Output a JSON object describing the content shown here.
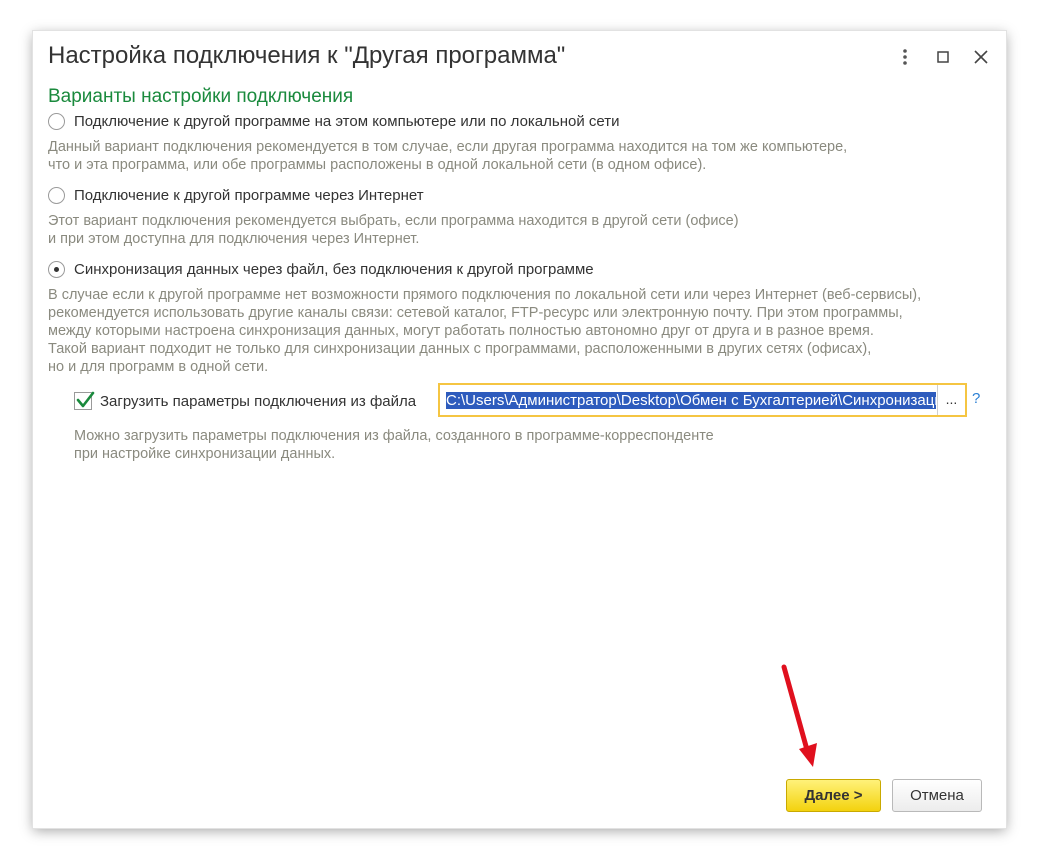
{
  "window": {
    "title": "Настройка подключения к \"Другая программа\"",
    "more_icon": "more-vertical-icon",
    "maximize_icon": "maximize-icon",
    "close_icon": "close-icon"
  },
  "section_title": "Варианты настройки подключения",
  "options": [
    {
      "label": "Подключение к другой программе на этом компьютере или по локальной сети",
      "selected": false,
      "description": [
        "Данный вариант подключения рекомендуется в том случае, если другая программа находится на том же компьютере,",
        "что и эта программа, или обе программы расположены в одной локальной сети (в одном офисе)."
      ]
    },
    {
      "label": "Подключение к другой программе через Интернет",
      "selected": false,
      "description": [
        "Этот вариант подключения рекомендуется выбрать, если программа находится в другой сети (офисе)",
        "и при этом доступна для подключения через Интернет."
      ]
    },
    {
      "label": "Синхронизация данных через файл, без подключения к другой программе",
      "selected": true,
      "description": [
        "В случае если к другой программе нет возможности прямого подключения по локальной сети или через Интернет (веб-сервисы),",
        "рекомендуется использовать другие каналы связи: сетевой каталог, FTP-ресурс или электронную почту. При этом программы,",
        "между которыми настроена синхронизация данных, могут работать полностью автономно друг от друга и в разное время.",
        "Такой вариант подходит не только для синхронизации данных с программами, расположенными в других сетях (офисах),",
        "но и для программ в одной сети."
      ]
    }
  ],
  "load_params": {
    "checked": true,
    "label": "Загрузить параметры подключения из файла",
    "path_value": "C:\\Users\\Администратор\\Desktop\\Обмен с Бухгалтерией\\Синхронизация",
    "browse_label": "...",
    "help_label": "?",
    "description": [
      "Можно загрузить параметры подключения из файла, созданного в программе-корреспонденте",
      "при настройке синхронизации данных."
    ]
  },
  "buttons": {
    "next_label": "Далее >",
    "cancel_label": "Отмена"
  },
  "colors": {
    "section_title": "#1a8a3d",
    "description_text": "#8a8a7f",
    "primary_button": "#f3d20e",
    "selection": "#2d5bbd",
    "field_focus": "#f5c542",
    "annotation_arrow": "#e0101e"
  }
}
